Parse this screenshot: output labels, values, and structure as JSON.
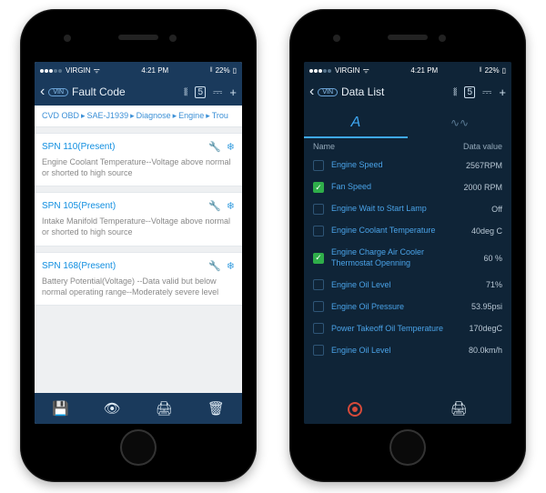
{
  "status": {
    "carrier": "VIRGIN",
    "time": "4:21 PM",
    "battery": "22%"
  },
  "left": {
    "nav": {
      "vin": "VIN",
      "title": "Fault Code"
    },
    "crumbs": [
      "CVD OBD",
      "SAE-J1939",
      "Diagnose",
      "Engine",
      "Trou"
    ],
    "faults": [
      {
        "spn": "SPN 110",
        "present": "(Present)",
        "desc": "Engine Coolant Temperature--Voltage above normal or shorted to high source"
      },
      {
        "spn": "SPN 105",
        "present": "(Present)",
        "desc": "Intake Manifold Temperature--Voltage above normal or shorted to high source"
      },
      {
        "spn": "SPN 168",
        "present": "(Present)",
        "desc": "Battery Potential(Voltage) --Data valid but below normal operating range--Moderately severe level"
      }
    ]
  },
  "right": {
    "nav": {
      "vin": "VIN",
      "title": "Data List"
    },
    "tabs": {
      "a": "A",
      "b": "⋀⋁"
    },
    "thead": {
      "name": "Name",
      "value": "Data value"
    },
    "rows": [
      {
        "checked": false,
        "name": "Engine Speed",
        "value": "2567RPM"
      },
      {
        "checked": true,
        "name": "Fan Speed",
        "value": "2000 RPM"
      },
      {
        "checked": false,
        "name": "Engine Wait to Start Lamp",
        "value": "Off"
      },
      {
        "checked": false,
        "name": "Engine Coolant Temperature",
        "value": "40deg C"
      },
      {
        "checked": true,
        "name": "Engine Charge Air Cooler Thermostat Openning",
        "value": "60 %"
      },
      {
        "checked": false,
        "name": "Engine Oil Level",
        "value": "71%"
      },
      {
        "checked": false,
        "name": "Engine Oil Pressure",
        "value": "53.95psi"
      },
      {
        "checked": false,
        "name": "Power Takeoff   Oil Temperature",
        "value": "170degC"
      },
      {
        "checked": false,
        "name": "Engine Oil Level",
        "value": "80.0km/h"
      }
    ]
  }
}
